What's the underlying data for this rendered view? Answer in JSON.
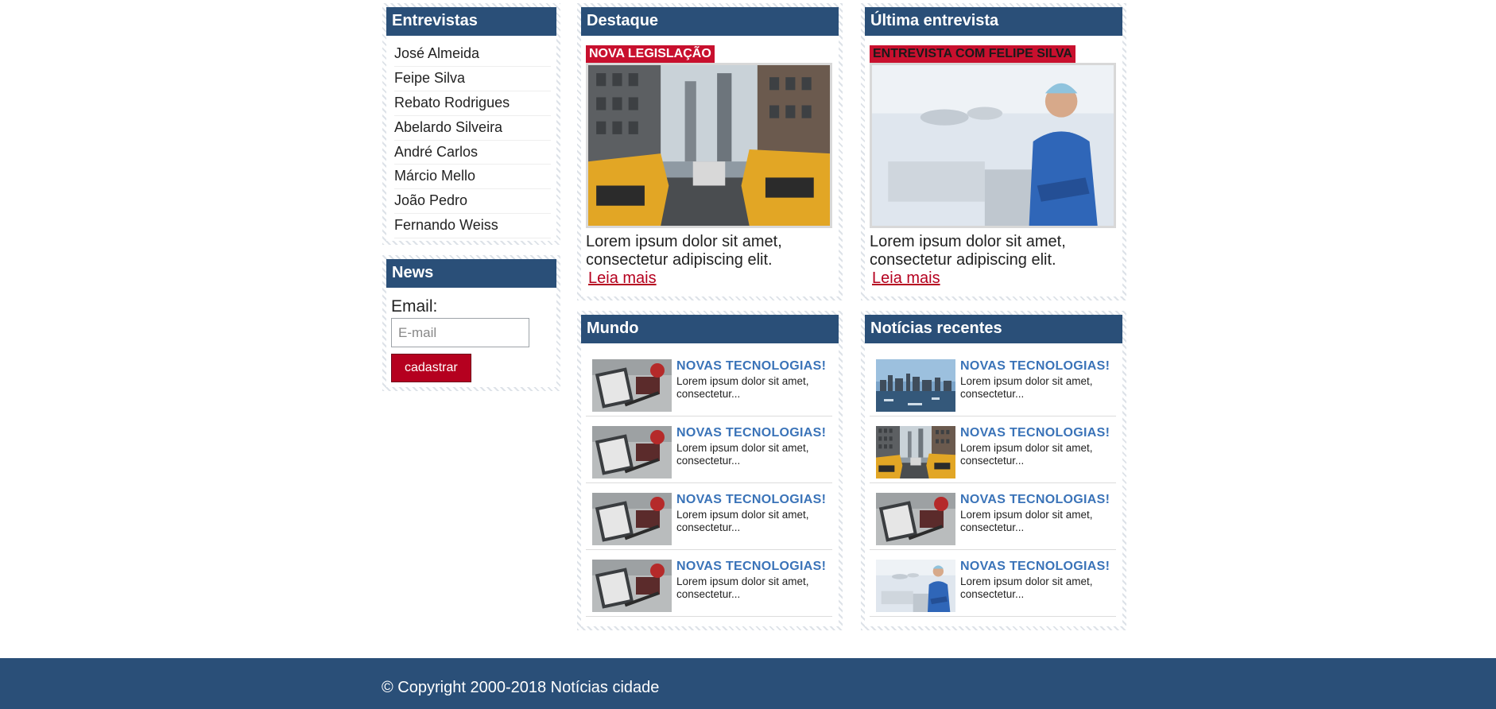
{
  "interviews": {
    "title": "Entrevistas",
    "items": [
      "José Almeida",
      "Feipe Silva",
      "Rebato Rodrigues",
      "Abelardo Silveira",
      "André Carlos",
      "Márcio Mello",
      "João Pedro",
      "Fernando Weiss"
    ]
  },
  "news_signup": {
    "title": "News",
    "email_label": "Email:",
    "email_placeholder": "E-mail",
    "submit_label": "cadastrar"
  },
  "featured": {
    "title": "Destaque",
    "tag": "NOVA LEGISLAÇÃO",
    "image": "city-taxi-street-photo",
    "text": "Lorem ipsum dolor sit amet, consectetur adipiscing elit.",
    "link": "Leia mais"
  },
  "latest_interview": {
    "title": "Última entrevista",
    "tag": "ENTREVISTA COM FELIPE SILVA",
    "image": "surgeon-portrait-photo",
    "text": "Lorem ipsum dolor sit amet, consectetur adipiscing elit.",
    "link": "Leia mais"
  },
  "world": {
    "title": "Mundo",
    "items": [
      {
        "title": "NOVAS TECNOLOGIAS!",
        "snippet": "Lorem ipsum dolor sit amet, consectetur...",
        "image": "desk-notebook-photo"
      },
      {
        "title": "NOVAS TECNOLOGIAS!",
        "snippet": "Lorem ipsum dolor sit amet, consectetur...",
        "image": "desk-notebook-photo"
      },
      {
        "title": "NOVAS TECNOLOGIAS!",
        "snippet": "Lorem ipsum dolor sit amet, consectetur...",
        "image": "desk-notebook-photo"
      },
      {
        "title": "NOVAS TECNOLOGIAS!",
        "snippet": "Lorem ipsum dolor sit amet, consectetur...",
        "image": "desk-notebook-photo"
      }
    ]
  },
  "recent": {
    "title": "Notícias recentes",
    "items": [
      {
        "title": "NOVAS TECNOLOGIAS!",
        "snippet": "Lorem ipsum dolor sit amet, consectetur...",
        "image": "city-skyline-photo"
      },
      {
        "title": "NOVAS TECNOLOGIAS!",
        "snippet": "Lorem ipsum dolor sit amet, consectetur...",
        "image": "city-taxi-street-photo"
      },
      {
        "title": "NOVAS TECNOLOGIAS!",
        "snippet": "Lorem ipsum dolor sit amet, consectetur...",
        "image": "desk-notebook-photo"
      },
      {
        "title": "NOVAS TECNOLOGIAS!",
        "snippet": "Lorem ipsum dolor sit amet, consectetur...",
        "image": "surgeon-portrait-photo"
      }
    ]
  },
  "footer": {
    "copyright": "© Copyright 2000-2018 Notícias cidade"
  },
  "colors": {
    "header_bg": "#2a4f78",
    "accent_red": "#c8102e",
    "link_red": "#b5001f",
    "news_title_blue": "#3a73b8"
  }
}
